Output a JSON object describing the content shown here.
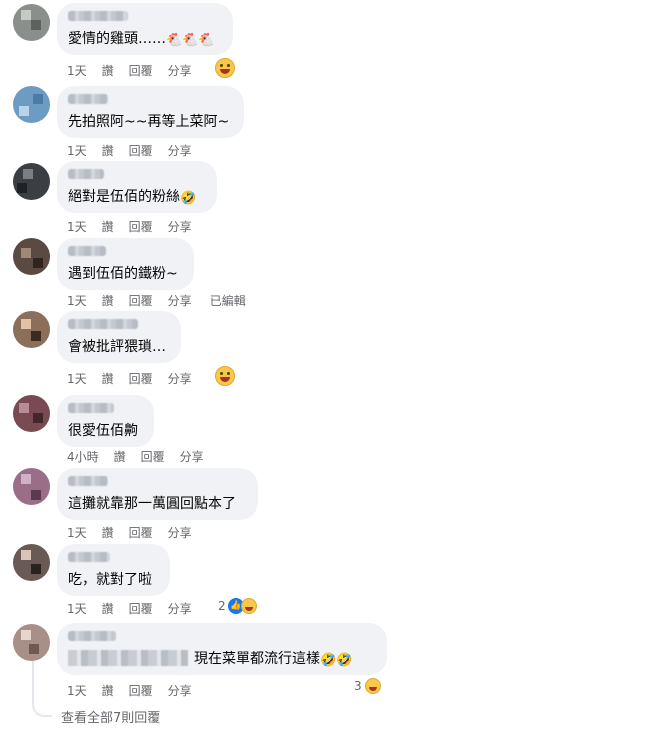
{
  "actions": {
    "like": "讚",
    "reply": "回覆",
    "share": "分享",
    "edited": "已編輯"
  },
  "comments": [
    {
      "text": "愛情的雞頭……",
      "emoji": "🐔🐔🐔",
      "time": "1天",
      "reaction_count": ""
    },
    {
      "text": "先拍照阿~~再等上菜阿~",
      "emoji": "",
      "time": "1天",
      "reaction_count": ""
    },
    {
      "text": "絕對是伍佰的粉絲",
      "emoji": "🤣",
      "time": "1天",
      "reaction_count": ""
    },
    {
      "text": "遇到伍佰的鐵粉~",
      "emoji": "",
      "time": "1天",
      "reaction_count": ""
    },
    {
      "text": "會被批評猥瑣…",
      "emoji": "",
      "time": "1天",
      "reaction_count": ""
    },
    {
      "text": "很愛伍佰齁",
      "emoji": "",
      "time": "4小時",
      "reaction_count": ""
    },
    {
      "text": "這攤就靠那一萬圓回點本了",
      "emoji": "",
      "time": "1天",
      "reaction_count": ""
    },
    {
      "text": "吃，就對了啦",
      "emoji": "",
      "time": "1天",
      "reaction_count": "2"
    },
    {
      "text": "現在菜單都流行這樣",
      "emoji": "🤣🤣",
      "time": "1天",
      "reaction_count": "3"
    }
  ],
  "view_more_replies": "查看全部7則回覆",
  "colors": {
    "bubble": "#f0f2f5",
    "meta": "#65676b",
    "like_blue": "#1877f2"
  }
}
